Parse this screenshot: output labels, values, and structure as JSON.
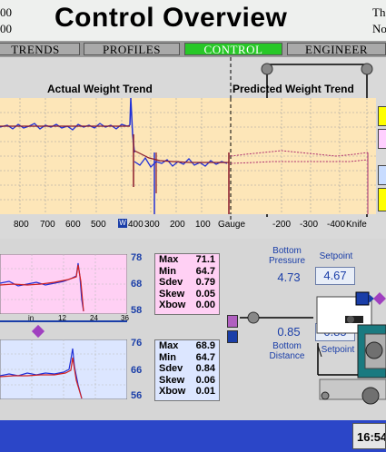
{
  "header": {
    "title": "Control Overview",
    "left_line1": "00",
    "left_line2": "00",
    "right_line1": "Th",
    "right_line2": "No"
  },
  "nav": {
    "tabs": [
      {
        "label": "TRENDS",
        "active": false
      },
      {
        "label": "PROFILES",
        "active": false
      },
      {
        "label": "CONTROL",
        "active": true
      },
      {
        "label": "ENGINEER",
        "active": false
      }
    ]
  },
  "trend": {
    "actual_title": "Actual Weight Trend",
    "predicted_title": "Predicted Weight Trend",
    "x_ticks_left": [
      "800",
      "700",
      "600",
      "500",
      "400",
      "300",
      "200",
      "100",
      "Gauge"
    ],
    "wind_marker": "W",
    "x_ticks_right": [
      "-200",
      "-300",
      "-400",
      "Knife"
    ],
    "colors": {
      "plot_bg": "#fde6b8",
      "actual": "#2030d8",
      "actual_mean": "#8a1a2a",
      "predicted": "#b03070"
    }
  },
  "bottom_control": {
    "pressure_label": "Bottom Pressure",
    "pressure_value": "4.73",
    "pressure_setpoint_label": "Setpoint",
    "pressure_setpoint": "4.67",
    "distance_label": "Bottom Distance",
    "distance_value": "0.85",
    "distance_setpoint_label": "Setpoint",
    "distance_setpoint": "0.85"
  },
  "panel_top": {
    "scale": [
      "78",
      "68",
      "58"
    ],
    "x_axis": [
      "in",
      "12",
      "24",
      "36"
    ],
    "stats": [
      {
        "label": "Max",
        "value": "71.1"
      },
      {
        "label": "Min",
        "value": "64.7"
      },
      {
        "label": "Sdev",
        "value": "0.79"
      },
      {
        "label": "Skew",
        "value": "0.05"
      },
      {
        "label": "Xbow",
        "value": "0.00"
      }
    ]
  },
  "panel_bottom": {
    "scale": [
      "76",
      "66",
      "56"
    ],
    "stats": [
      {
        "label": "Max",
        "value": "68.9"
      },
      {
        "label": "Min",
        "value": "64.7"
      },
      {
        "label": "Sdev",
        "value": "0.84"
      },
      {
        "label": "Skew",
        "value": "0.06"
      },
      {
        "label": "Xbow",
        "value": "0.01"
      }
    ]
  },
  "footer": {
    "clock": "16:54"
  }
}
